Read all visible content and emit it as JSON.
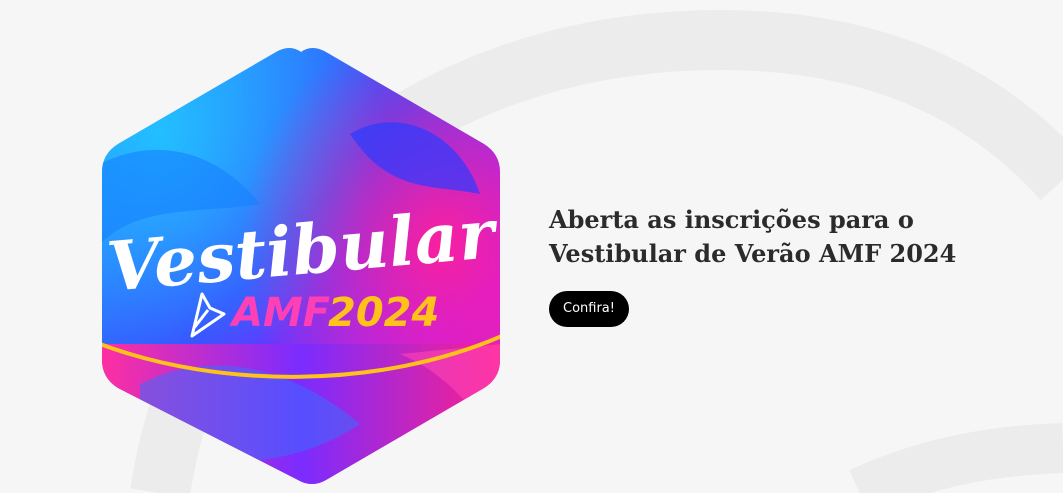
{
  "banner": {
    "badge": {
      "script_word": "Vestibular",
      "brand": "AMF",
      "year": "2024"
    },
    "headline": {
      "line1": "Aberta as inscrições para o",
      "line2": "Vestibular de Verão AMF 2024"
    },
    "cta_label": "Confira!"
  },
  "colors": {
    "page_background": "#f6f6f6",
    "decorative_arc": "#ececec",
    "headline_text": "#2b2b2b",
    "button_background": "#000000",
    "button_text": "#ffffff",
    "badge_magenta": "#ff1f9a",
    "badge_blue": "#1f5bff",
    "badge_yellow": "#ffc21a"
  }
}
